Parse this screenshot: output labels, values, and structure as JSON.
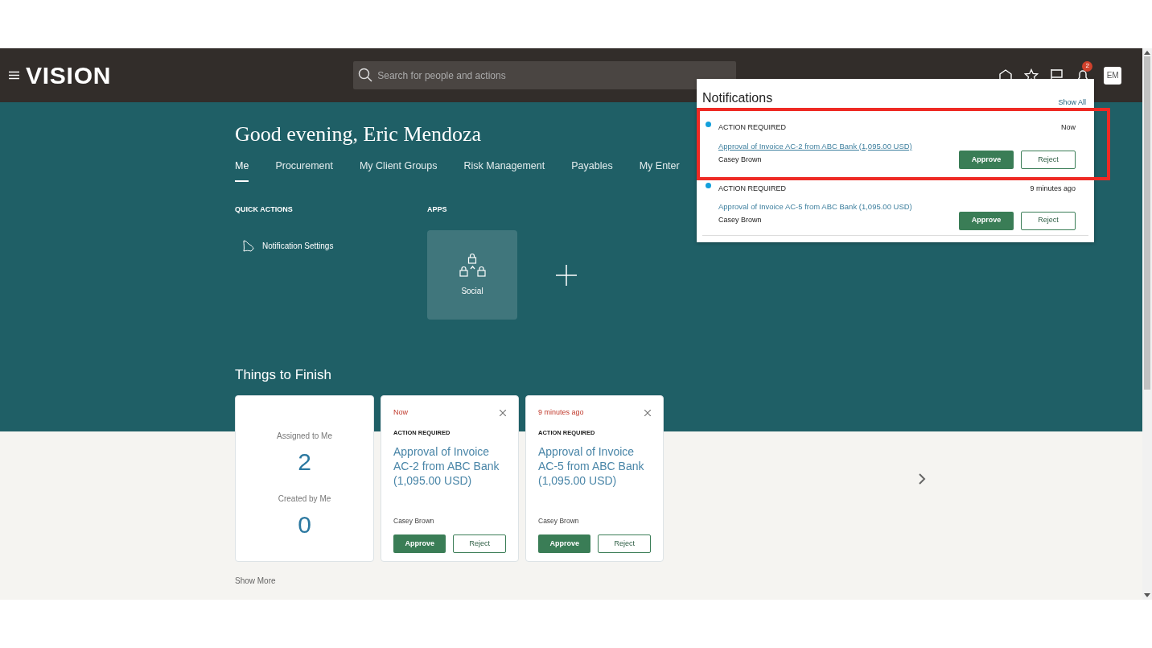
{
  "header": {
    "logo": "VISION",
    "search": {
      "placeholder": "Search for people and actions"
    },
    "notification_count": "2",
    "avatar": "EM"
  },
  "greeting": "Good evening, Eric Mendoza",
  "tabs": [
    {
      "label": "Me",
      "selected": true
    },
    {
      "label": "Procurement",
      "selected": false
    },
    {
      "label": "My Client Groups",
      "selected": false
    },
    {
      "label": "Risk Management",
      "selected": false
    },
    {
      "label": "Payables",
      "selected": false
    },
    {
      "label": "My Enter",
      "selected": false
    }
  ],
  "quick_actions": {
    "title": "QUICK ACTIONS",
    "items": [
      "Notification Settings"
    ]
  },
  "apps": {
    "title": "APPS",
    "items": [
      "Social"
    ]
  },
  "things_to_finish": {
    "title": "Things to Finish",
    "summary": [
      {
        "label": "Assigned to Me",
        "count": "2"
      },
      {
        "label": "Created by Me",
        "count": "0"
      }
    ],
    "cards": [
      {
        "time": "Now",
        "status": "ACTION REQUIRED",
        "title": "Approval of Invoice AC-2 from ABC Bank (1,095.00 USD)",
        "from": "Casey Brown",
        "actions": [
          "Approve",
          "Reject"
        ]
      },
      {
        "time": "9 minutes ago",
        "status": "ACTION REQUIRED",
        "title": "Approval of Invoice AC-5 from ABC Bank (1,095.00 USD)",
        "from": "Casey Brown",
        "actions": [
          "Approve",
          "Reject"
        ]
      }
    ],
    "show_more": "Show More"
  },
  "notifications": {
    "title": "Notifications",
    "show_all": "Show All",
    "items": [
      {
        "status": "ACTION REQUIRED",
        "time": "Now",
        "title": "Approval of Invoice AC-2 from ABC Bank (1,095.00 USD)",
        "from": "Casey Brown",
        "unread": true,
        "focused": true,
        "highlighted": true,
        "actions": [
          "Approve",
          "Reject"
        ]
      },
      {
        "status": "ACTION REQUIRED",
        "time": "9 minutes ago",
        "title": "Approval of Invoice AC-5 from ABC Bank (1,095.00 USD)",
        "from": "Casey Brown",
        "unread": true,
        "focused": false,
        "highlighted": false,
        "actions": [
          "Approve",
          "Reject"
        ]
      }
    ]
  }
}
